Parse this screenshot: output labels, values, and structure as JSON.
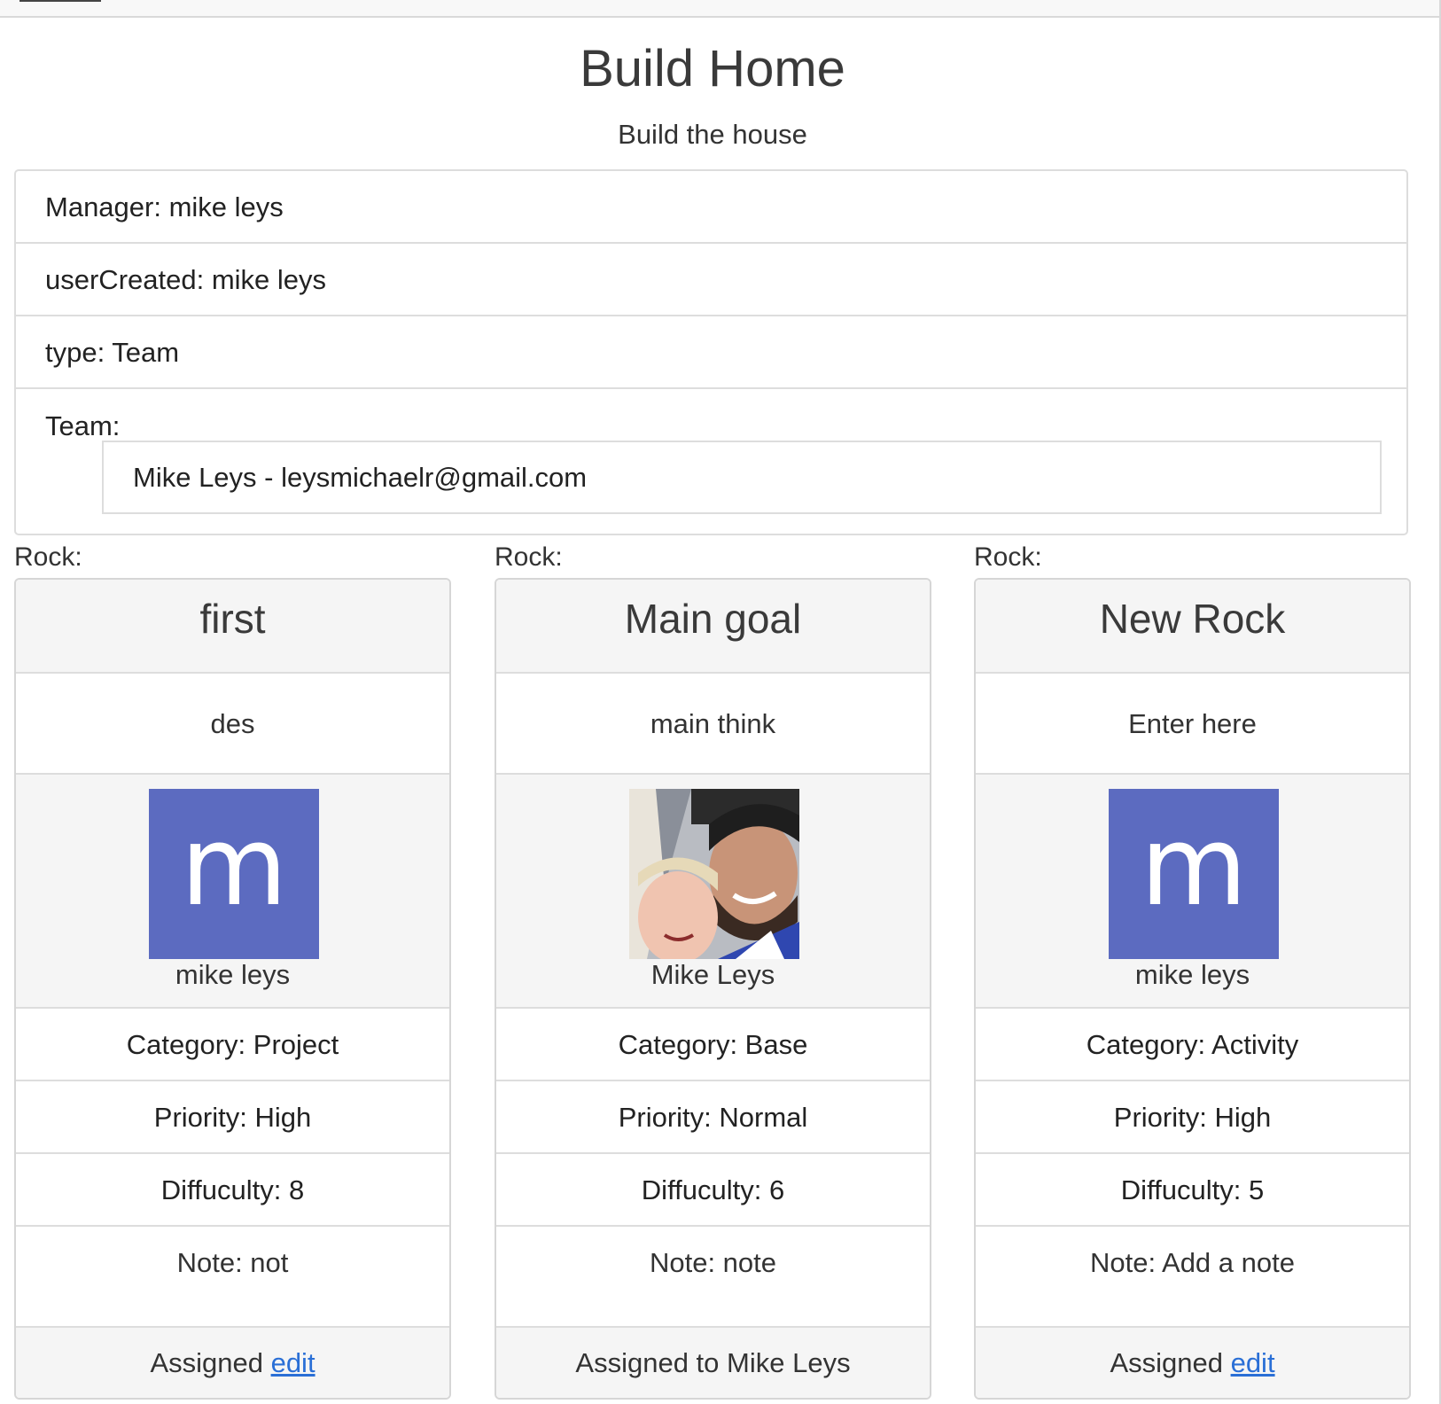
{
  "header": {
    "title": "Build Home",
    "subtitle": "Build the house"
  },
  "info": {
    "manager": "Manager: mike leys",
    "user_created": "userCreated: mike leys",
    "type": "type: Team",
    "team_label": "Team:",
    "team_members": [
      "Mike Leys - leysmichaelr@gmail.com"
    ]
  },
  "colors": {
    "avatar_bg": "#5c6bc0",
    "link": "#2a6fd6"
  },
  "rocks": [
    {
      "label": "Rock:",
      "title": "first",
      "description": "des",
      "avatar": {
        "type": "initial",
        "letter": "m",
        "icon": "letter-avatar"
      },
      "user_name": "mike leys",
      "category": "Category: Project",
      "priority": "Priority: High",
      "difficulty": "Diffuculty: 8",
      "note": "Note: not",
      "assigned_text": "Assigned ",
      "edit_label": "edit"
    },
    {
      "label": "Rock:",
      "title": "Main goal",
      "description": "main think",
      "avatar": {
        "type": "photo",
        "icon": "user-photo"
      },
      "user_name": "Mike Leys",
      "category": "Category: Base",
      "priority": "Priority: Normal",
      "difficulty": "Diffuculty: 6",
      "note": "Note: note",
      "assigned_text": "Assigned to Mike Leys",
      "edit_label": ""
    },
    {
      "label": "Rock:",
      "title": "New Rock",
      "description": "Enter here",
      "avatar": {
        "type": "initial",
        "letter": "m",
        "icon": "letter-avatar"
      },
      "user_name": "mike leys",
      "category": "Category: Activity",
      "priority": "Priority: High",
      "difficulty": "Diffuculty: 5",
      "note": "Note: Add a note",
      "assigned_text": "Assigned ",
      "edit_label": "edit"
    }
  ]
}
